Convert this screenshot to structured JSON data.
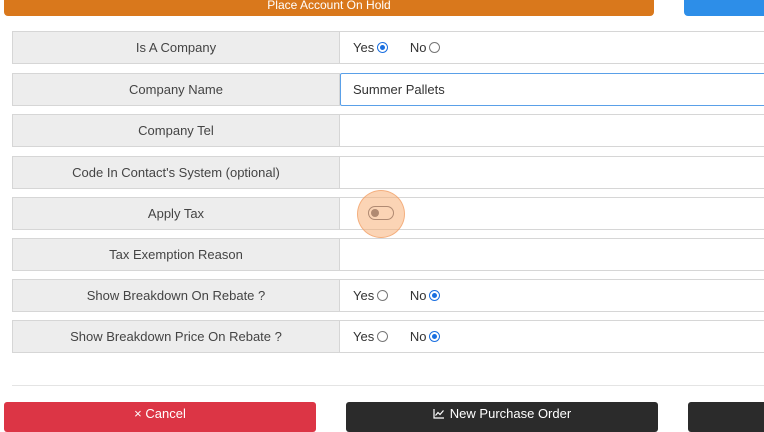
{
  "top_actions": {
    "hold_label": "Place Account On Hold"
  },
  "form": {
    "rows": [
      {
        "label": "Is A Company",
        "type": "radio",
        "options": [
          {
            "label": "Yes",
            "checked": true
          },
          {
            "label": "No",
            "checked": false
          }
        ]
      },
      {
        "label": "Company Name",
        "type": "text",
        "value": "Summer Pallets"
      },
      {
        "label": "Company Tel",
        "type": "text",
        "value": ""
      },
      {
        "label": "Code In Contact's System (optional)",
        "type": "text",
        "value": ""
      },
      {
        "label": "Apply Tax",
        "type": "toggle",
        "on": false
      },
      {
        "label": "Tax Exemption Reason",
        "type": "text",
        "value": ""
      },
      {
        "label": "Show Breakdown On Rebate ?",
        "type": "radio",
        "options": [
          {
            "label": "Yes",
            "checked": false
          },
          {
            "label": "No",
            "checked": true
          }
        ]
      },
      {
        "label": "Show Breakdown Price On Rebate ?",
        "type": "radio",
        "options": [
          {
            "label": "Yes",
            "checked": false
          },
          {
            "label": "No",
            "checked": true
          }
        ]
      }
    ]
  },
  "bottom_actions": {
    "cancel_label": "× Cancel",
    "new_po_label": "New Purchase Order",
    "new_po_icon": "chart-line-icon"
  },
  "colors": {
    "orange": "#d9781c",
    "blue": "#2d8ee8",
    "red": "#dc3545",
    "dark": "#2b2b2b",
    "radio_checked": "#1a6fe0"
  }
}
